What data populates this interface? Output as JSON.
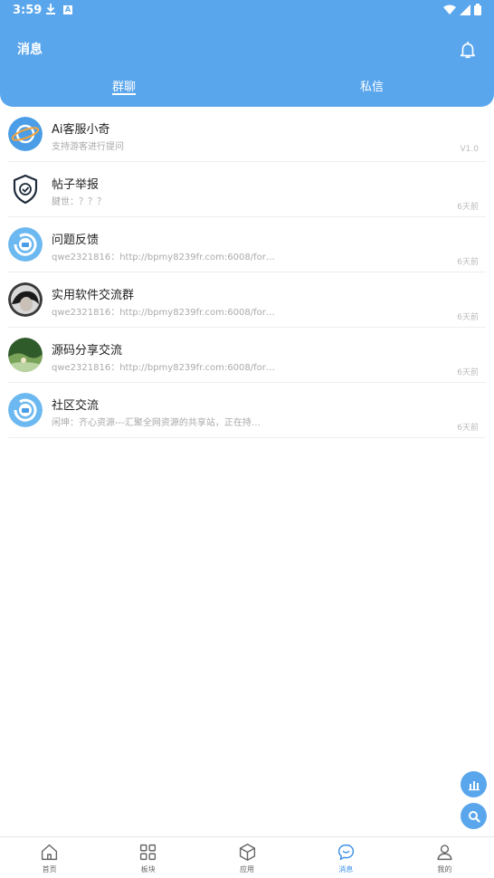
{
  "status_bar": {
    "time": "3:59",
    "badge": "A"
  },
  "header": {
    "title": "消息"
  },
  "tabs": [
    {
      "label": "群聊",
      "active": true
    },
    {
      "label": "私信",
      "active": false
    }
  ],
  "conversations": [
    {
      "name": "Ai客服小奇",
      "preview": "支持游客进行提问",
      "time": "V1.0",
      "avatar": "ai-bot-avatar"
    },
    {
      "name": "帖子举报",
      "preview": "腱世：？？？",
      "time": "6天前",
      "avatar": "shield-avatar"
    },
    {
      "name": "问题反馈",
      "preview": "qwe2321816：http://bpmy8239fr.com:6008/for…",
      "time": "6天前",
      "avatar": "qi-logo-avatar"
    },
    {
      "name": "实用软件交流群",
      "preview": "qwe2321816：http://bpmy8239fr.com:6008/for…",
      "time": "6天前",
      "avatar": "photo-avatar"
    },
    {
      "name": "源码分享交流",
      "preview": "qwe2321816：http://bpmy8239fr.com:6008/for…",
      "time": "6天前",
      "avatar": "landscape-avatar"
    },
    {
      "name": "社区交流",
      "preview": "闲坤：齐心资源---汇聚全网资源的共享站，正在持…",
      "time": "6天前",
      "avatar": "qi-logo-avatar"
    }
  ],
  "bottom_nav": [
    {
      "label": "首页",
      "icon": "home-icon",
      "active": false
    },
    {
      "label": "板块",
      "icon": "grid-icon",
      "active": false
    },
    {
      "label": "应用",
      "icon": "box-icon",
      "active": false
    },
    {
      "label": "消息",
      "icon": "chat-icon",
      "active": true
    },
    {
      "label": "我的",
      "icon": "person-icon",
      "active": false
    }
  ],
  "colors": {
    "primary": "#5aa6ec",
    "active_nav": "#3a8ee6"
  }
}
